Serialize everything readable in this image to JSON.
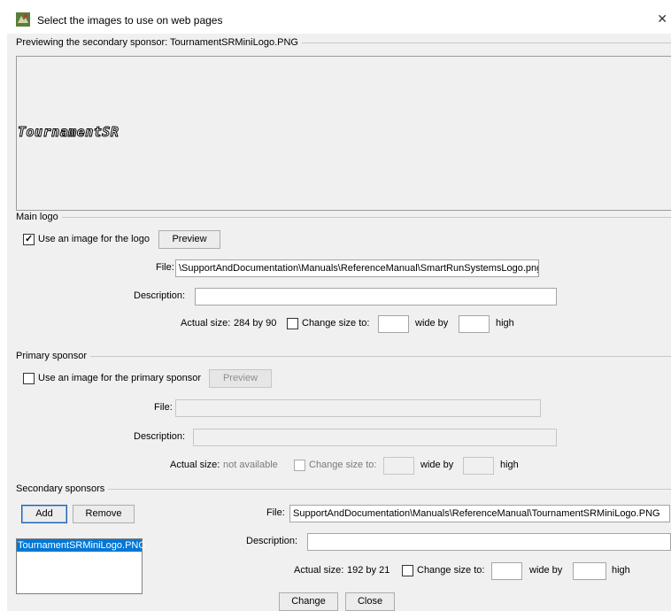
{
  "window": {
    "title": "Select the images to use on web pages"
  },
  "preview": {
    "caption": "Previewing the secondary sponsor: TournamentSRMiniLogo.PNG",
    "logo_text": "TournamentSR"
  },
  "main_logo": {
    "group_title": "Main logo",
    "checkbox_label": "Use an image for the logo",
    "checked": true,
    "preview_button": "Preview",
    "file_label": "File:",
    "file_value": "\\SupportAndDocumentation\\Manuals\\ReferenceManual\\SmartRunSystemsLogo.png",
    "description_label": "Description:",
    "description_value": "",
    "actual_size_label": "Actual size:",
    "actual_size_value": "284 by 90",
    "change_size_label": "Change size to:",
    "wide_by_label": "wide by",
    "high_label": "high"
  },
  "primary_sponsor": {
    "group_title": "Primary sponsor",
    "checkbox_label": "Use an image for the primary sponsor",
    "checked": false,
    "preview_button": "Preview",
    "file_label": "File:",
    "file_value": "",
    "description_label": "Description:",
    "description_value": "",
    "actual_size_label": "Actual size:",
    "actual_size_value": "not available",
    "change_size_label": "Change size to:",
    "wide_by_label": "wide by",
    "high_label": "high"
  },
  "secondary_sponsors": {
    "group_title": "Secondary sponsors",
    "add_button": "Add",
    "remove_button": "Remove",
    "list_items": [
      "TournamentSRMiniLogo.PNG"
    ],
    "file_label": "File:",
    "file_value": "SupportAndDocumentation\\Manuals\\ReferenceManual\\TournamentSRMiniLogo.PNG",
    "description_label": "Description:",
    "description_value": "",
    "actual_size_label": "Actual size:",
    "actual_size_value": "192 by 21",
    "change_size_label": "Change size to:",
    "wide_by_label": "wide by",
    "high_label": "high"
  },
  "footer": {
    "change_button": "Change",
    "close_button": "Close"
  }
}
